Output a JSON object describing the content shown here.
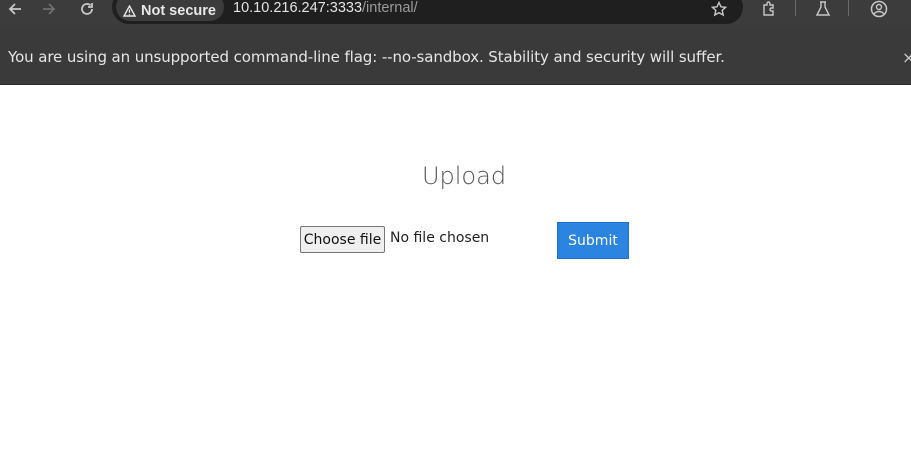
{
  "browser": {
    "security_label": "Not secure",
    "url_host": "10.10.216.247:3333",
    "url_path": "/internal/"
  },
  "infobar": {
    "message": "You are using an unsupported command-line flag: --no-sandbox. Stability and security will suffer.",
    "close_glyph": "×"
  },
  "page": {
    "title": "Upload",
    "choose_file_label": "Choose file",
    "file_status": "No file chosen",
    "submit_label": "Submit"
  },
  "colors": {
    "submit_bg": "#2a84e0",
    "toolbar_bg": "#3c3c3c",
    "infobar_bg": "#3a3a3a"
  }
}
